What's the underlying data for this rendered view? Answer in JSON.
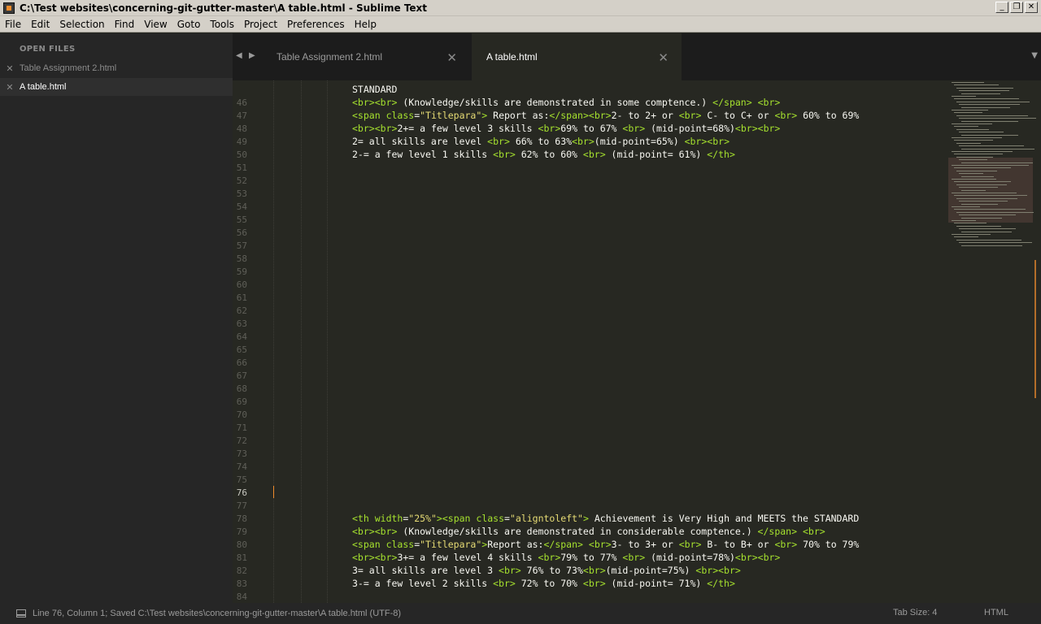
{
  "window": {
    "title": "C:\\Test websites\\concerning-git-gutter-master\\A table.html - Sublime Text",
    "buttons": [
      "_",
      "❐",
      "✕"
    ]
  },
  "menu": [
    "File",
    "Edit",
    "Selection",
    "Find",
    "View",
    "Goto",
    "Tools",
    "Project",
    "Preferences",
    "Help"
  ],
  "sidebar": {
    "header": "OPEN FILES",
    "files": [
      {
        "name": "Table Assignment 2.html",
        "active": false
      },
      {
        "name": "A table.html",
        "active": true
      }
    ]
  },
  "tabs": [
    {
      "label": "Table Assignment 2.html",
      "active": false
    },
    {
      "label": "A table.html",
      "active": true
    }
  ],
  "editor": {
    "top_partial": "STANDARD",
    "line_numbers": [
      46,
      47,
      48,
      49,
      50,
      51,
      52,
      53,
      54,
      55,
      56,
      57,
      58,
      59,
      60,
      61,
      62,
      63,
      64,
      65,
      66,
      67,
      68,
      69,
      70,
      71,
      72,
      73,
      74,
      75,
      76,
      77,
      78,
      79,
      80,
      81,
      82,
      83,
      84
    ],
    "current_line": 76,
    "code_lines": {
      "46": "<br><br> (Knowledge/skills are demonstrated in some comptence.) </span> <br>",
      "47": "<span class=\"Titlepara\"> Report as:</span><br>2- to 2+ or <br> C- to C+ or <br> 60% to 69%",
      "48": "<br><br>2+= a few level 3 skills <br>69% to 67% <br> (mid-point=68%)<br><br>",
      "49": "2= all skills are level <br> 66% to 63%<br>(mid-point=65%) <br><br>",
      "50": "2-= a few level 1 skills <br> 62% to 60% <br> (mid-point= 61%) </th>",
      "78": "<th width=\"25%\"><span class=\"aligntoleft\"> Achievement is Very High and MEETS the STANDARD",
      "79": "<br><br> (Knowledge/skills are demonstrated in considerable comptence.) </span> <br>",
      "80": "<span class=\"Titlepara\">Report as:</span> <br>3- to 3+ or <br> B- to B+ or <br> 70% to 79%",
      "81": "<br><br>3+= a few level 4 skills <br>79% to 77% <br> (mid-point=78%)<br><br>",
      "82": "3= all skills are level 3 <br> 76% to 73%<br>(mid-point=75%) <br><br>",
      "83": "3-= a few level 2 skills <br> 72% to 70% <br> (mid-point= 71%) </th>"
    }
  },
  "status": {
    "message": "Line 76, Column 1; Saved C:\\Test websites\\concerning-git-gutter-master\\A table.html (UTF-8)",
    "tab_size": "Tab Size: 4",
    "syntax": "HTML"
  },
  "colors": {
    "background": "#272822",
    "sidebar": "#262626",
    "tag": "#a6e22e",
    "string": "#e6db74",
    "caret": "#f08c2c"
  }
}
